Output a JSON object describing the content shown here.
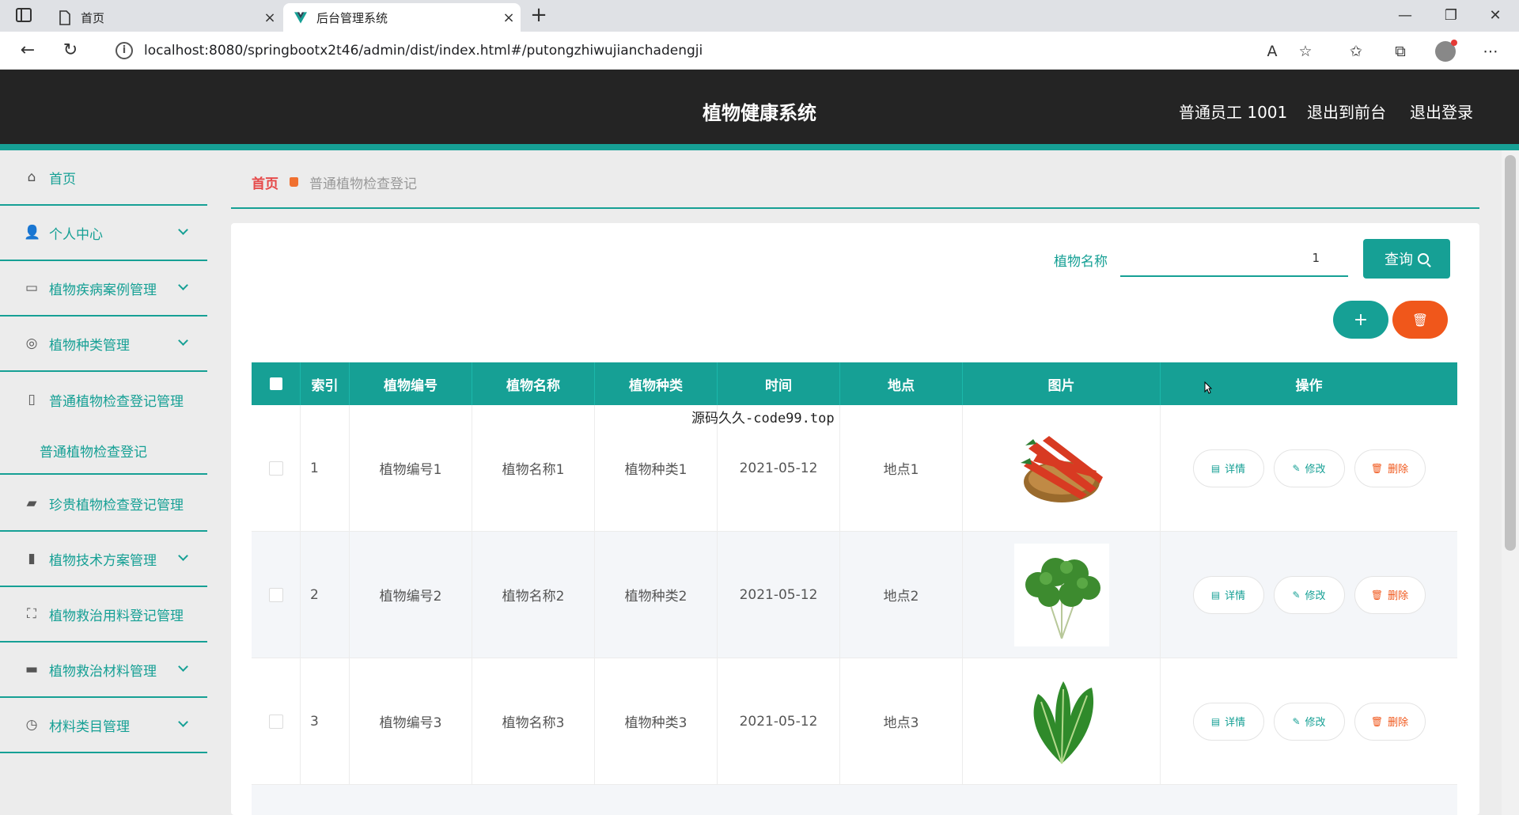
{
  "browser": {
    "tabs": [
      {
        "label": "首页",
        "icon": "page-icon"
      },
      {
        "label": "后台管理系统",
        "icon": "vue-icon"
      }
    ],
    "url": "localhost:8080/springbootx2t46/admin/dist/index.html#/putongzhiwujianchadengji"
  },
  "header": {
    "title": "植物健康系统",
    "user": "普通员工 1001",
    "to_front": "退出到前台",
    "logout": "退出登录"
  },
  "sidebar": {
    "items": [
      {
        "label": "首页",
        "icon": "home-icon",
        "expandable": false
      },
      {
        "label": "个人中心",
        "icon": "user-icon",
        "expandable": true
      },
      {
        "label": "植物疾病案例管理",
        "icon": "message-icon",
        "expandable": true
      },
      {
        "label": "植物种类管理",
        "icon": "compass-icon",
        "expandable": true
      },
      {
        "label": "普通植物检查登记管理",
        "icon": "phone-icon",
        "expandable": false
      },
      {
        "label": "普通植物检查登记",
        "sub": true
      },
      {
        "label": "珍贵植物检查登记管理",
        "icon": "wallet-icon",
        "expandable": false
      },
      {
        "label": "植物技术方案管理",
        "icon": "chart-icon",
        "expandable": true
      },
      {
        "label": "植物救治用料登记管理",
        "icon": "crop-icon",
        "expandable": false
      },
      {
        "label": "植物救治材料管理",
        "icon": "suitcase-icon",
        "expandable": true
      },
      {
        "label": "材料类目管理",
        "icon": "clock-icon",
        "expandable": true
      }
    ]
  },
  "breadcrumb": {
    "home": "首页",
    "current": "普通植物检查登记"
  },
  "search": {
    "label": "植物名称",
    "value": "1",
    "placeholder": "植物名称",
    "button": "查询"
  },
  "table": {
    "headers": [
      "",
      "索引",
      "植物编号",
      "植物名称",
      "植物种类",
      "时间",
      "地点",
      "图片",
      "操作"
    ],
    "rows": [
      {
        "index": "1",
        "code": "植物编号1",
        "name": "植物名称1",
        "type": "植物种类1",
        "time": "2021-05-12",
        "place": "地点1",
        "image": "carrots"
      },
      {
        "index": "2",
        "code": "植物编号2",
        "name": "植物名称2",
        "type": "植物种类2",
        "time": "2021-05-12",
        "place": "地点2",
        "image": "coriander"
      },
      {
        "index": "3",
        "code": "植物编号3",
        "name": "植物名称3",
        "type": "植物种类3",
        "time": "2021-05-12",
        "place": "地点3",
        "image": "spinach"
      }
    ],
    "actions": {
      "detail": "详情",
      "edit": "修改",
      "delete": "删除"
    }
  },
  "overlay_text": "源码久久-code99.top",
  "colors": {
    "accent": "#16a095",
    "danger": "#f0571b",
    "header_bg": "#242424"
  }
}
